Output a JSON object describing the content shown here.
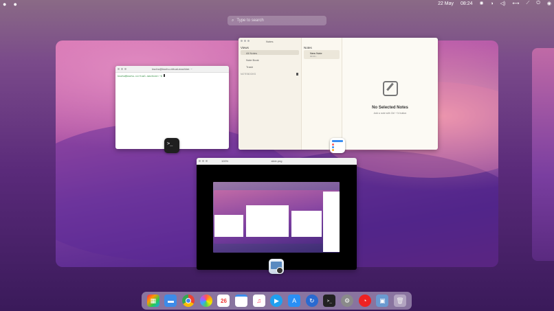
{
  "menubar": {
    "apple": "",
    "date": "22 May",
    "time": "08:24"
  },
  "search": {
    "placeholder": "Type to search"
  },
  "terminal": {
    "title": "ksohu@ksohu-virtual-machine: ~",
    "prompt": "ksohu@ksohu-virtual-machine:~$"
  },
  "notes": {
    "window_title": "Notes",
    "views_label": "Views",
    "views": [
      "All Notes",
      "Note Book",
      "Trash"
    ],
    "notebooks_label": "NOTEBOOKS",
    "list_title": "Notes",
    "note_item_title": "New Note",
    "note_item_sub": "00:00 •",
    "empty_title": "No Selected Notes",
    "empty_sub": "Add a note with Ctrl + N button"
  },
  "preview": {
    "title": "slide.png",
    "zoom": "100%"
  },
  "colors": {
    "accent": "#3a8ef0",
    "notes_bg": "#fcfaf4"
  },
  "dock": {
    "icons": [
      "launchpad-icon",
      "files-icon",
      "chrome-icon",
      "photos-icon",
      "calendar-icon",
      "notes-icon",
      "music-icon",
      "player-icon",
      "appstore-icon",
      "sync-icon",
      "terminal-icon",
      "settings-icon",
      "help-icon",
      "preview-icon",
      "trash-icon"
    ],
    "calendar_day": "26"
  }
}
